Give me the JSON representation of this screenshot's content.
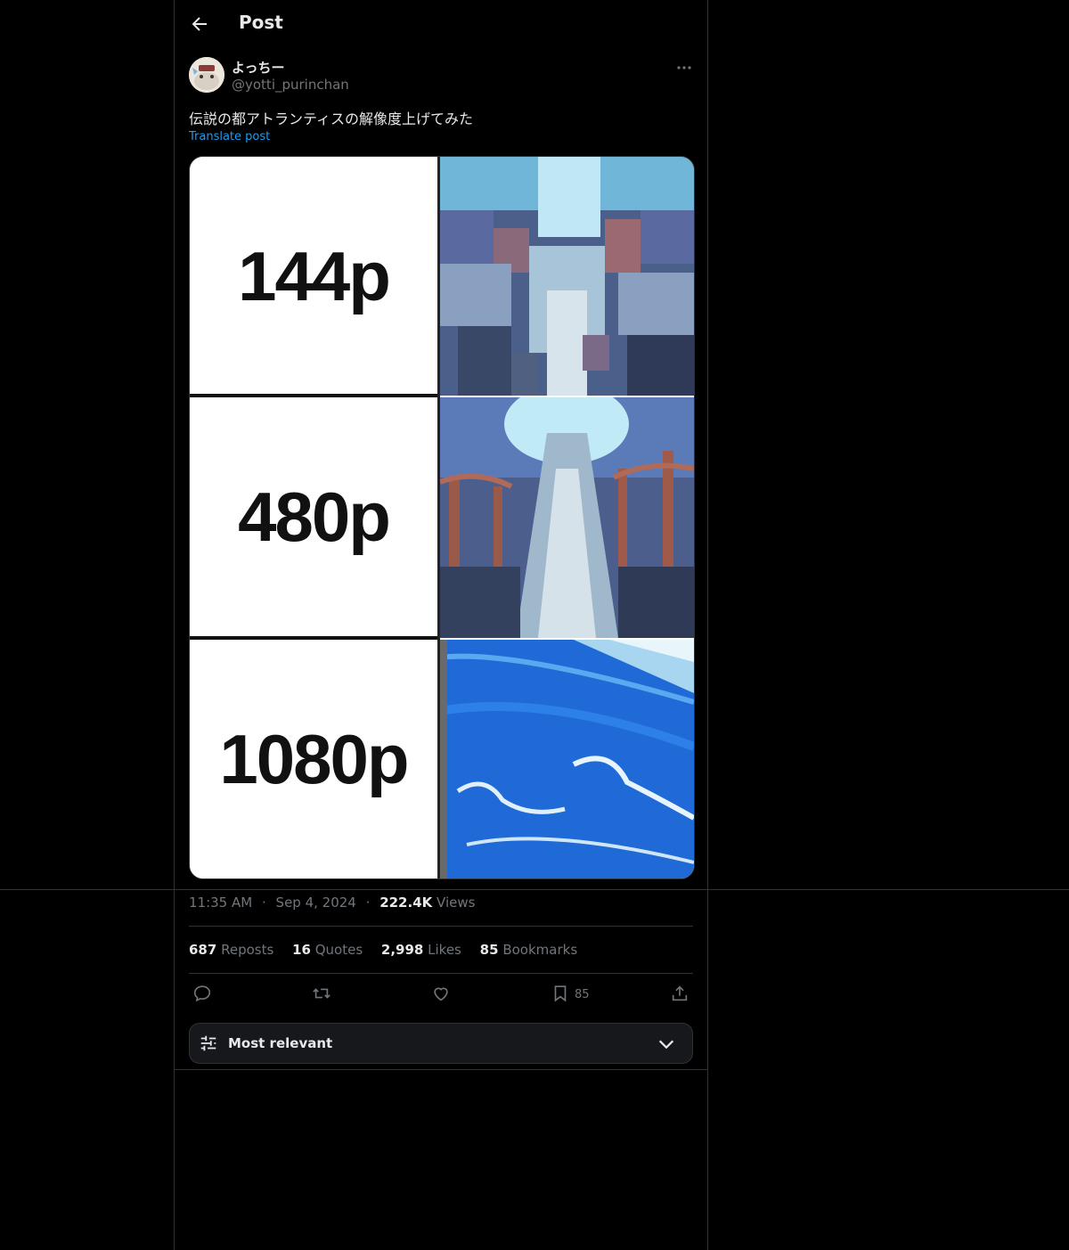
{
  "header": {
    "title": "Post"
  },
  "author": {
    "display_name": "よっちー",
    "handle": "@yotti_purinchan"
  },
  "post": {
    "text": "伝説の都アトランティスの解像度上げてみた",
    "translate_label": "Translate post",
    "media_labels": [
      "144p",
      "480p",
      "1080p"
    ]
  },
  "meta": {
    "time": "11:35 AM",
    "date": "Sep 4, 2024",
    "views_count": "222.4K",
    "views_label": "Views",
    "separator": "·"
  },
  "stats": {
    "reposts_count": "687",
    "reposts_label": "Reposts",
    "quotes_count": "16",
    "quotes_label": "Quotes",
    "likes_count": "2,998",
    "likes_label": "Likes",
    "bookmarks_count": "85",
    "bookmarks_label": "Bookmarks"
  },
  "actions": {
    "bookmark_count": "85"
  },
  "sort": {
    "label": "Most relevant"
  },
  "colors": {
    "background": "#000000",
    "border": "#2f3336",
    "text": "#e7e9ea",
    "muted": "#71767b",
    "link": "#1d9bf0"
  },
  "icons": [
    "back-arrow-icon",
    "more-icon",
    "reply-icon",
    "repost-icon",
    "like-icon",
    "bookmark-icon",
    "share-icon",
    "filter-icon",
    "chevron-down-icon"
  ]
}
